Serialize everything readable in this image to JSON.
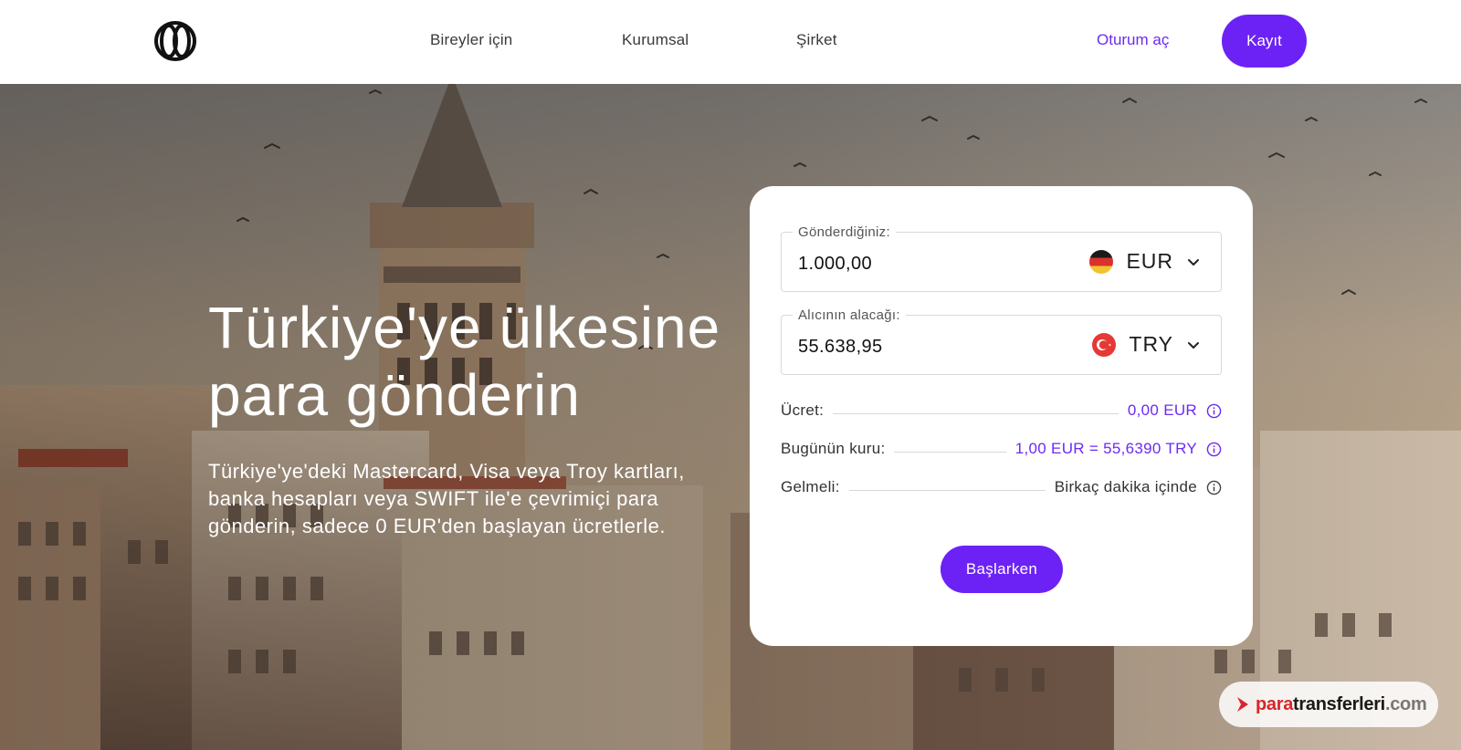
{
  "header": {
    "logo_icon": "circle-logo-icon",
    "nav": [
      "Bireyler için",
      "Kurumsal",
      "Şirket"
    ],
    "login_label": "Oturum aç",
    "signup_label": "Kayıt"
  },
  "hero": {
    "title": "Türkiye'ye ülkesine para gönderin",
    "subtitle": "Türkiye'ye'deki Mastercard, Visa veya Troy kartları, banka hesapları veya SWIFT ile'e çevrimiçi para gönderin, sadece 0 EUR'den başlayan ücretlerle."
  },
  "calculator": {
    "send": {
      "label": "Gönderdiğiniz:",
      "value": "1.000,00",
      "currency": "EUR",
      "flag_icon": "germany-flag-icon"
    },
    "receive": {
      "label": "Alıcının alacağı:",
      "value": "55.638,95",
      "currency": "TRY",
      "flag_icon": "turkey-flag-icon"
    },
    "fee": {
      "label": "Ücret:",
      "value": "0,00 EUR"
    },
    "rate": {
      "label": "Bugünün kuru:",
      "value": "1,00 EUR = 55,6390 TRY"
    },
    "eta": {
      "label": "Gelmeli:",
      "value": "Birkaç dakika içinde"
    },
    "cta_label": "Başlarken"
  },
  "watermark": {
    "text_a": "para",
    "text_b": "transferleri",
    "text_c": ".com"
  },
  "colors": {
    "accent": "#6c22f5",
    "link": "#6c2bf2"
  }
}
